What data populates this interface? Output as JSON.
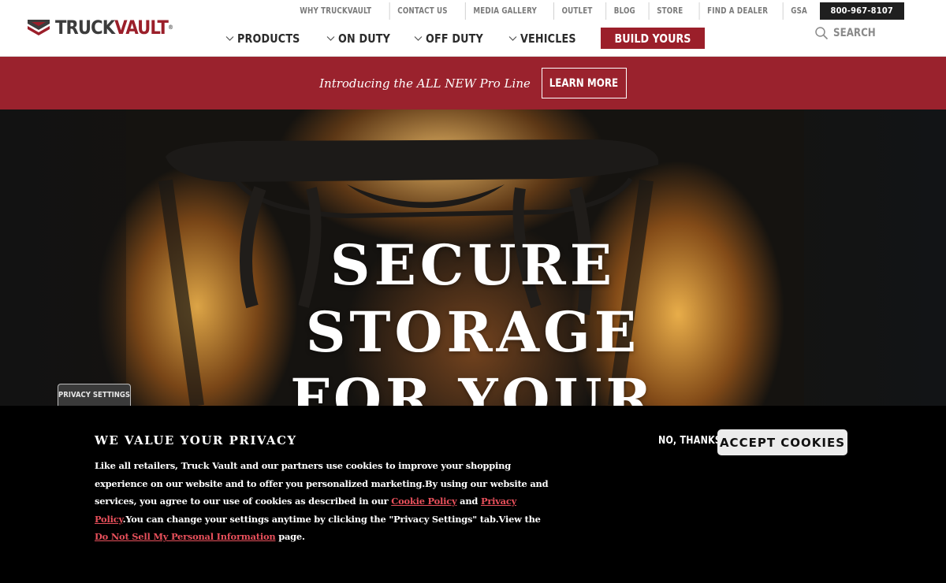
{
  "brand": {
    "name_part1": "TRUCK",
    "name_part2": "VAULT",
    "registered_mark": "®"
  },
  "utility_nav": {
    "items": [
      "WHY TRUCKVAULT",
      "CONTACT US",
      "MEDIA GALLERY",
      "OUTLET",
      "BLOG",
      "STORE",
      "FIND A DEALER",
      "GSA"
    ],
    "phone": "800-967-8107"
  },
  "main_nav": {
    "items": [
      "PRODUCTS",
      "ON DUTY",
      "OFF DUTY",
      "VEHICLES"
    ],
    "cta": "BUILD YOURS"
  },
  "search": {
    "label": "SEARCH"
  },
  "promo": {
    "text": "Introducing the ALL NEW Pro Line",
    "button": "LEARN MORE"
  },
  "hero": {
    "lines": [
      "SECURE",
      "STORAGE",
      "FOR YOUR"
    ]
  },
  "privacy_tab": "PRIVACY SETTINGS",
  "cookie_banner": {
    "title": "WE VALUE YOUR PRIVACY",
    "body_1": "Like all retailers, Truck Vault and our partners use cookies to improve your shopping experience on our website and to offer you personalized marketing.By using our website and services, you agree to our use of cookies as described in our ",
    "cookie_policy_link": "Cookie Policy",
    "body_and": " and ",
    "privacy_policy_link": "Privacy Policy",
    "body_2": ".You can change your settings anytime by clicking the \"Privacy Settings\" tab.View the ",
    "do_not_sell_link": "Do Not Sell My Personal Information",
    "body_3": " page.",
    "decline": "NO, THANKS",
    "accept": "ACCEPT COOKIES"
  },
  "colors": {
    "brand_red": "#9b1f2a",
    "promo_red": "#9a222d",
    "link_red": "#e8505b",
    "dark": "#1f1f1f"
  }
}
